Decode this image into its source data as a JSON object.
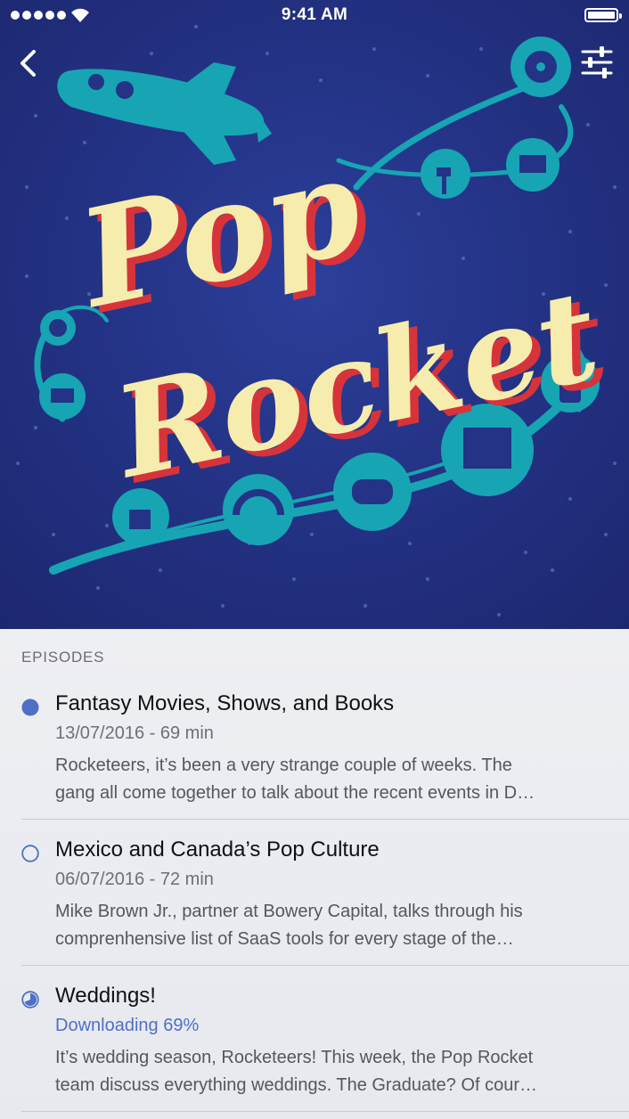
{
  "status_bar": {
    "time": "9:41 AM"
  },
  "podcast": {
    "title_line1": "Pop",
    "title_line2": "Rocket"
  },
  "episodes_header": "EPISODES",
  "episodes": [
    {
      "title": "Fantasy Movies, Shows, and Books",
      "meta": "13/07/2016 - 69 min",
      "description_line1": "Rocketeers, it’s been a very strange couple of weeks. The",
      "description_line2": "gang all come together to talk about the recent events in D…",
      "state": "new"
    },
    {
      "title": "Mexico and Canada’s Pop Culture",
      "meta": "06/07/2016 - 72 min",
      "description_line1": "Mike Brown Jr., partner at Bowery Capital, talks through his",
      "description_line2": "comprenhensive list of SaaS tools for every stage of the…",
      "state": "played"
    },
    {
      "title": "Weddings!",
      "meta": "Downloading 69%",
      "download_progress": 0.69,
      "description_line1": "It’s wedding season, Rocketeers! This week, the Pop Rocket",
      "description_line2": "team discuss everything weddings. The Graduate? Of cour…",
      "state": "downloading"
    }
  ],
  "colors": {
    "accent": "#4f6fc6",
    "artwork_background": "#243386",
    "artwork_teal": "#17a5b4",
    "artwork_title": "#f6ecad",
    "artwork_shadow": "#d6343a"
  }
}
